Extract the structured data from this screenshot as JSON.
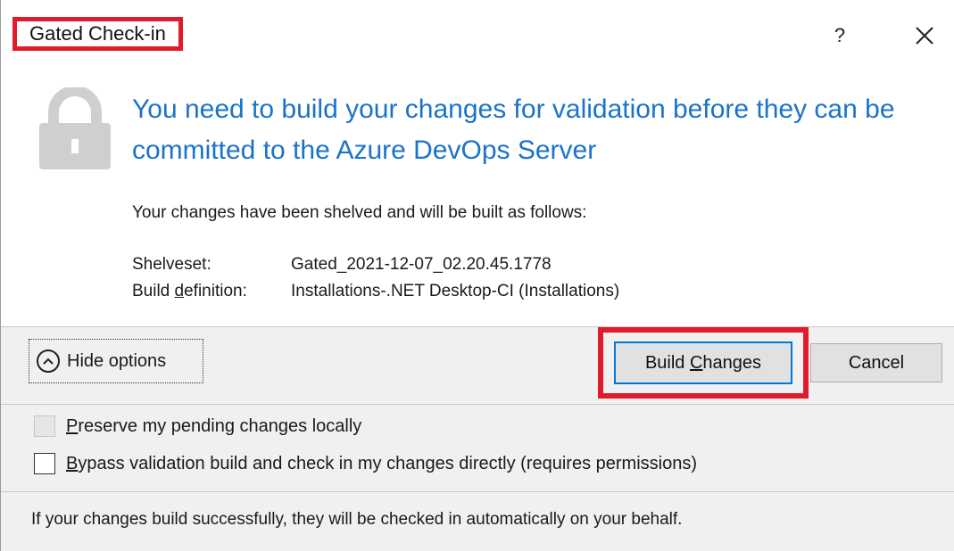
{
  "window": {
    "title": "Gated Check-in",
    "help_label": "?",
    "close_icon": "close-icon"
  },
  "message": {
    "icon": "lock-icon",
    "headline": "You need to build your changes for validation before they can be committed to the Azure DevOps Server",
    "summary": "Your changes have been shelved and will be built as follows:",
    "shelveset_label": "Shelveset:",
    "shelveset_value": "Gated_2021-12-07_02.20.45.1778",
    "build_def_label_pre": "Build ",
    "build_def_label_access": "d",
    "build_def_label_post": "efinition:",
    "build_def_value": "Installations-.NET Desktop-CI (Installations)"
  },
  "actions": {
    "hide_options_label": "Hide options",
    "build_pre": "Build ",
    "build_access": "C",
    "build_post": "hanges",
    "cancel_label": "Cancel"
  },
  "options": {
    "preserve_access": "P",
    "preserve_rest": "reserve my pending changes locally",
    "preserve_checked": false,
    "preserve_disabled": true,
    "bypass_access": "B",
    "bypass_rest": "ypass validation build and check in my changes directly (requires permissions)",
    "bypass_checked": false
  },
  "footer": {
    "info": "If your changes build successfully, they will be checked in automatically on your behalf."
  },
  "colors": {
    "highlight": "#e21b2c",
    "headline": "#1b73c9",
    "focus_border": "#0078d7"
  }
}
